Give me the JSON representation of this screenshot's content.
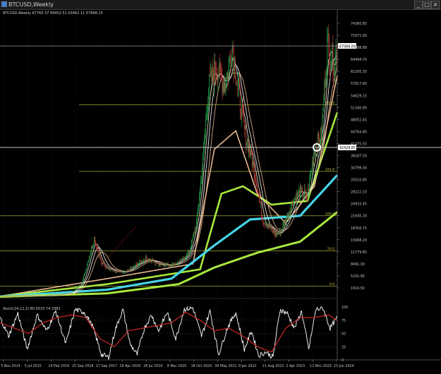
{
  "window": {
    "title": "BTCUSD,Weekly",
    "buttons": [
      "_",
      "□",
      "×"
    ]
  },
  "legend": {
    "symbol_line": "BTCUSD,Weekly  67765.37 69452.51 63462.11 67968.15"
  },
  "colors": {
    "background": "#000000",
    "grid": "#2e2e2e",
    "fib_line": "#c8c840",
    "candle_up": "#1fa64a",
    "candle_down": "#c83c3c",
    "ma_light": "#f0e8d8",
    "ma_tan": "#e8b890",
    "ma_green": "#a8e83c",
    "ma_cyan": "#46d4e8",
    "trendline": "#d03030",
    "stoch_main": "#ffffff",
    "stoch_signal": "#d02828",
    "price_tag_bg": "#ffffff",
    "marker": "#ffffff"
  },
  "price_axis": {
    "ticks": [
      "74360.85",
      "71071.60",
      "67988.88",
      "64494.70",
      "61205.35",
      "57917.60",
      "54629.15",
      "51340.90",
      "48052.45",
      "44764.80",
      "41475.55",
      "38187.50",
      "34799.00",
      "33510.85",
      "28222.10",
      "24933.45",
      "21645.20",
      "18356.75",
      "15068.20",
      "11779.85",
      "8491.30",
      "5202.95",
      "1914.50"
    ],
    "current_price_label": "67988.88",
    "crosshair_label": "42428.85"
  },
  "fib_levels": [
    {
      "label": "261.8",
      "price": 52000
    },
    {
      "label": "161.8",
      "price": 34000
    },
    {
      "label": "100.0",
      "price": 22000
    },
    {
      "label": "50.0",
      "price": 12500
    },
    {
      "label": "0.0",
      "price": 3000
    }
  ],
  "time_axis": {
    "labels": [
      "3 Nov 2014",
      "5 Jul 2015",
      "14 Feb 2016",
      "25 Sep 2016",
      "17 Sep 2017",
      "29 Apr 2018",
      "28 Jul 2019",
      "8 Mar 2020",
      "18 Oct 2020",
      "30 May 2021",
      "9 Jan 2022",
      "21 Aug 2022",
      "2 Apr 2023",
      "12 Nov 2023",
      "23 Jun 2024"
    ]
  },
  "stoch_panel": {
    "label": "Stoch(24,12,2) 80.0533 74.3382",
    "ticks": [
      "100",
      "75",
      "50",
      "25",
      "0"
    ],
    "main_value": 80.0533,
    "signal_value": 74.3382
  },
  "chart_data": {
    "type": "line",
    "title": "BTCUSD,Weekly",
    "ohlc_last": {
      "open": 67765.37,
      "high": 69452.51,
      "low": 63462.11,
      "close": 67968.15
    },
    "ylim": [
      0,
      76000
    ],
    "price_anchors": [
      [
        0,
        300
      ],
      [
        60,
        350
      ],
      [
        80,
        700
      ],
      [
        100,
        1100
      ],
      [
        115,
        4000
      ],
      [
        125,
        11000
      ],
      [
        132,
        16000
      ],
      [
        142,
        9000
      ],
      [
        160,
        7000
      ],
      [
        175,
        6500
      ],
      [
        185,
        8000
      ],
      [
        205,
        10500
      ],
      [
        220,
        9000
      ],
      [
        240,
        8700
      ],
      [
        255,
        10000
      ],
      [
        265,
        12500
      ],
      [
        275,
        20000
      ],
      [
        283,
        35000
      ],
      [
        292,
        57000
      ],
      [
        302,
        62000
      ],
      [
        315,
        57000
      ],
      [
        325,
        68000
      ],
      [
        334,
        55000
      ],
      [
        342,
        45000
      ],
      [
        352,
        38000
      ],
      [
        360,
        30000
      ],
      [
        368,
        21000
      ],
      [
        375,
        19500
      ],
      [
        385,
        17000
      ],
      [
        392,
        17500
      ],
      [
        400,
        21000
      ],
      [
        410,
        26000
      ],
      [
        420,
        28500
      ],
      [
        430,
        27000
      ],
      [
        440,
        40000
      ],
      [
        450,
        44000
      ],
      [
        458,
        69000
      ],
      [
        468,
        63000
      ],
      [
        472,
        67968
      ]
    ],
    "stoch_anchors": {
      "main": [
        [
          0,
          80
        ],
        [
          12,
          45
        ],
        [
          25,
          88
        ],
        [
          38,
          20
        ],
        [
          52,
          85
        ],
        [
          65,
          55
        ],
        [
          78,
          92
        ],
        [
          92,
          30
        ],
        [
          105,
          95
        ],
        [
          118,
          90
        ],
        [
          130,
          62
        ],
        [
          142,
          10
        ],
        [
          152,
          5
        ],
        [
          162,
          60
        ],
        [
          172,
          95
        ],
        [
          182,
          30
        ],
        [
          192,
          10
        ],
        [
          202,
          60
        ],
        [
          212,
          85
        ],
        [
          222,
          55
        ],
        [
          234,
          90
        ],
        [
          246,
          40
        ],
        [
          258,
          96
        ],
        [
          270,
          98
        ],
        [
          282,
          45
        ],
        [
          294,
          92
        ],
        [
          306,
          10
        ],
        [
          318,
          60
        ],
        [
          330,
          90
        ],
        [
          342,
          20
        ],
        [
          352,
          55
        ],
        [
          362,
          8
        ],
        [
          372,
          15
        ],
        [
          382,
          5
        ],
        [
          392,
          95
        ],
        [
          402,
          88
        ],
        [
          412,
          60
        ],
        [
          422,
          92
        ],
        [
          432,
          20
        ],
        [
          442,
          95
        ],
        [
          452,
          98
        ],
        [
          462,
          60
        ],
        [
          472,
          80
        ]
      ],
      "signal": [
        [
          0,
          70
        ],
        [
          20,
          60
        ],
        [
          40,
          50
        ],
        [
          60,
          70
        ],
        [
          80,
          80
        ],
        [
          100,
          85
        ],
        [
          120,
          80
        ],
        [
          140,
          40
        ],
        [
          160,
          25
        ],
        [
          180,
          55
        ],
        [
          200,
          60
        ],
        [
          220,
          65
        ],
        [
          240,
          70
        ],
        [
          260,
          90
        ],
        [
          280,
          75
        ],
        [
          300,
          55
        ],
        [
          320,
          60
        ],
        [
          340,
          45
        ],
        [
          360,
          25
        ],
        [
          380,
          15
        ],
        [
          400,
          60
        ],
        [
          420,
          80
        ],
        [
          440,
          80
        ],
        [
          460,
          85
        ],
        [
          472,
          74
        ]
      ]
    },
    "series": [
      {
        "values": [
          [
            0,
            200
          ],
          [
            150,
            5000
          ],
          [
            270,
            9000
          ],
          [
            300,
            40000
          ],
          [
            330,
            45000
          ],
          [
            360,
            28000
          ],
          [
            400,
            20000
          ],
          [
            440,
            30000
          ],
          [
            472,
            60000
          ]
        ]
      },
      {
        "values": [
          [
            0,
            200
          ],
          [
            150,
            3500
          ],
          [
            280,
            7500
          ],
          [
            310,
            28000
          ],
          [
            340,
            30000
          ],
          [
            380,
            25000
          ],
          [
            430,
            26000
          ],
          [
            472,
            50000
          ]
        ]
      },
      {
        "values": [
          [
            0,
            150
          ],
          [
            150,
            2000
          ],
          [
            240,
            5000
          ],
          [
            300,
            14000
          ],
          [
            350,
            21000
          ],
          [
            420,
            22000
          ],
          [
            472,
            33000
          ]
        ]
      },
      {
        "values": [
          [
            0,
            100
          ],
          [
            150,
            1000
          ],
          [
            250,
            3500
          ],
          [
            300,
            8000
          ],
          [
            360,
            12000
          ],
          [
            420,
            15000
          ],
          [
            472,
            23000
          ]
        ]
      }
    ]
  }
}
